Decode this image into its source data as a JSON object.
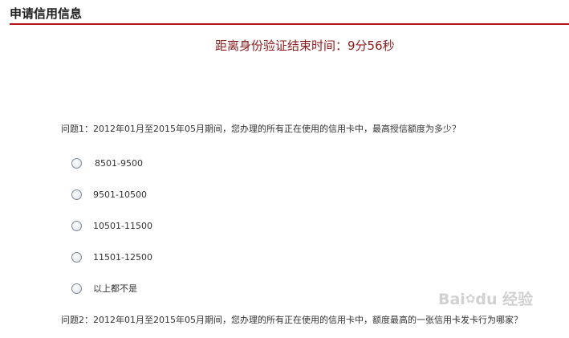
{
  "header": {
    "title": "申请信用信息"
  },
  "timer": {
    "text": "距离身份验证结束时间：9分56秒"
  },
  "questions": [
    {
      "text": "问题1：2012年01月至2015年05月期间，您办理的所有正在使用的信用卡中，最高授信额度为多少？",
      "options": [
        "8501-9500",
        "9501-10500",
        "10501-11500",
        "11501-12500",
        "以上都不是"
      ]
    },
    {
      "text": "问题2：2012年01月至2015年05月期间，您办理的所有正在使用的信用卡中，额度最高的一张信用卡发卡行为哪家？"
    }
  ],
  "watermark": {
    "text": "Bai",
    "paw": "✿",
    "suffix": "du 经验"
  }
}
